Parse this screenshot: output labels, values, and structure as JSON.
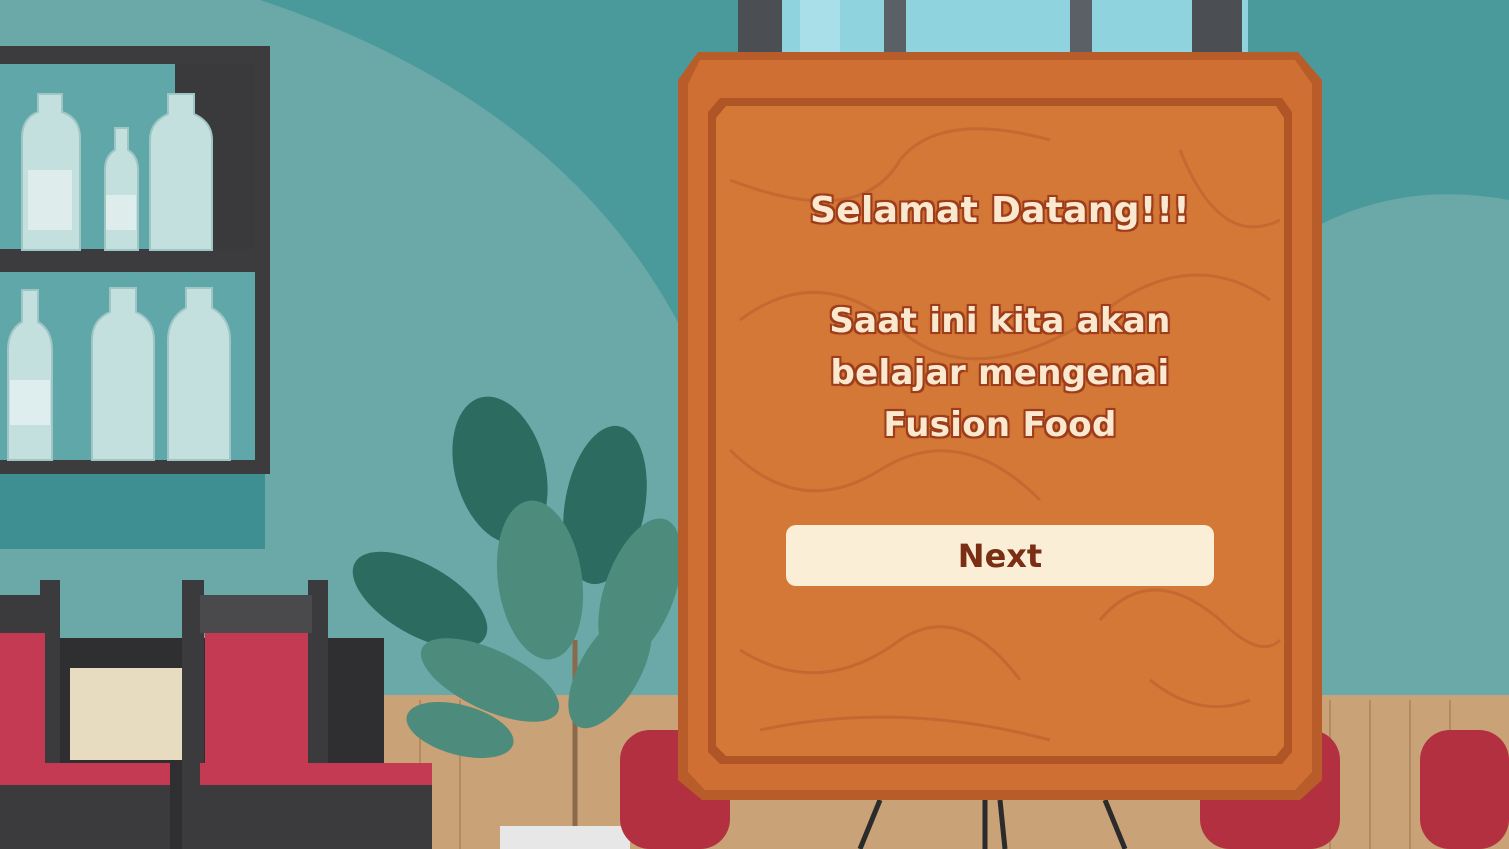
{
  "dialog": {
    "title": "Selamat Datang!!!",
    "message_lines": [
      "Saat ini kita akan",
      "belajar mengenai",
      "Fusion Food"
    ],
    "next_label": "Next"
  },
  "colors": {
    "wall": "#4a9a9c",
    "board_wood": "#c8682f",
    "board_inner": "#d77a3b",
    "text_fill": "#fbe9cf",
    "text_outline": "#9e3e1c",
    "button_bg": "#fbeed6",
    "button_text": "#7a2e14",
    "chair_cushion": "#c43a52"
  }
}
